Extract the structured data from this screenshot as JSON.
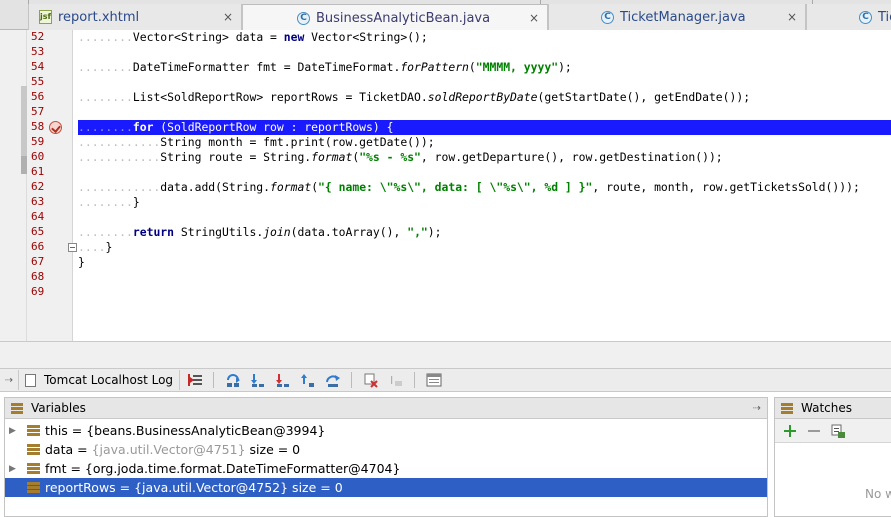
{
  "tabs": [
    {
      "label": "report.xhtml",
      "icon": "jsf-file-icon",
      "active": false
    },
    {
      "label": "BusinessAnalyticBean.java",
      "icon": "class-icon",
      "active": true
    },
    {
      "label": "TicketManager.java",
      "icon": "class-icon",
      "active": false
    },
    {
      "label": "Tic",
      "icon": "class-icon",
      "active": false
    }
  ],
  "tab_close_glyph": "×",
  "editor": {
    "line_numbers": [
      "52",
      "53",
      "54",
      "55",
      "56",
      "57",
      "58",
      "59",
      "60",
      "61",
      "62",
      "63",
      "64",
      "65",
      "66",
      "67",
      "68",
      "69"
    ],
    "lines": [
      {
        "t": [
          [
            "d",
            "........"
          ],
          [
            "p",
            "Vector<String> data = "
          ],
          [
            "k",
            "new"
          ],
          [
            "p",
            " Vector<String>();"
          ]
        ]
      },
      {
        "t": []
      },
      {
        "t": [
          [
            "d",
            "........"
          ],
          [
            "p",
            "DateTimeFormatter fmt = DateTimeFormat."
          ],
          [
            "i",
            "forPattern"
          ],
          [
            "p",
            "("
          ],
          [
            "s",
            "\"MMMM, yyyy\""
          ],
          [
            "p",
            ");"
          ]
        ]
      },
      {
        "t": []
      },
      {
        "t": [
          [
            "d",
            "........"
          ],
          [
            "p",
            "List<SoldReportRow> reportRows = TicketDAO."
          ],
          [
            "i",
            "soldReportByDate"
          ],
          [
            "p",
            "(getStartDate(), getEndDate());"
          ]
        ]
      },
      {
        "t": []
      },
      {
        "t": [
          [
            "d",
            "........"
          ],
          [
            "k",
            "for"
          ],
          [
            "p",
            " (SoldReportRow row : reportRows) {"
          ]
        ],
        "highlight": true
      },
      {
        "t": [
          [
            "d",
            "............"
          ],
          [
            "p",
            "String month = fmt.print(row.getDate());"
          ]
        ]
      },
      {
        "t": [
          [
            "d",
            "............"
          ],
          [
            "p",
            "String route = String."
          ],
          [
            "i",
            "format"
          ],
          [
            "p",
            "("
          ],
          [
            "s",
            "\"%s - %s\""
          ],
          [
            "p",
            ", row.getDeparture(), row.getDestination());"
          ]
        ]
      },
      {
        "t": []
      },
      {
        "t": [
          [
            "d",
            "............"
          ],
          [
            "p",
            "data.add(String."
          ],
          [
            "i",
            "format"
          ],
          [
            "p",
            "("
          ],
          [
            "s",
            "\"{ name: \\\"%s\\\", data: [ \\\"%s\\\", %d ] }\""
          ],
          [
            "p",
            ", route, month, row.getTicketsSold()));"
          ]
        ]
      },
      {
        "t": [
          [
            "d",
            "........"
          ],
          [
            "p",
            "}"
          ]
        ]
      },
      {
        "t": []
      },
      {
        "t": [
          [
            "d",
            "........"
          ],
          [
            "k",
            "return"
          ],
          [
            "p",
            " StringUtils."
          ],
          [
            "i",
            "join"
          ],
          [
            "p",
            "(data.toArray(), "
          ],
          [
            "s",
            "\",\""
          ],
          [
            "p",
            ");"
          ]
        ]
      },
      {
        "t": [
          [
            "d",
            "...."
          ],
          [
            "p",
            "}"
          ]
        ]
      },
      {
        "t": [
          [
            "p",
            "}"
          ]
        ]
      },
      {
        "t": []
      },
      {
        "t": []
      }
    ]
  },
  "debug": {
    "log_tab_label": "Tomcat Localhost Log",
    "pin_glyph": "⇢"
  },
  "variables": {
    "title": "Variables",
    "rows": [
      {
        "name": "this",
        "value": " = {beans.BusinessAnalyticBean@3994}",
        "ref": "",
        "size": "",
        "expandable": true,
        "selected": false
      },
      {
        "name": "data",
        "value": " = ",
        "ref": "{java.util.Vector@4751}",
        "size": " size = 0",
        "expandable": false,
        "selected": false
      },
      {
        "name": "fmt",
        "value": " = {org.joda.time.format.DateTimeFormatter@4704}",
        "ref": "",
        "size": "",
        "expandable": true,
        "selected": false
      },
      {
        "name": "reportRows",
        "value": " = {java.util.Vector@4752}",
        "ref": "",
        "size": " size = 0",
        "expandable": false,
        "selected": true
      }
    ]
  },
  "watches": {
    "title": "Watches",
    "empty_text": "No w"
  },
  "colors": {
    "highlight_line": "#1a1aff",
    "selection": "#2e5fc4",
    "keyword": "#000080",
    "string": "#008000",
    "line_number": "#9a0000"
  }
}
